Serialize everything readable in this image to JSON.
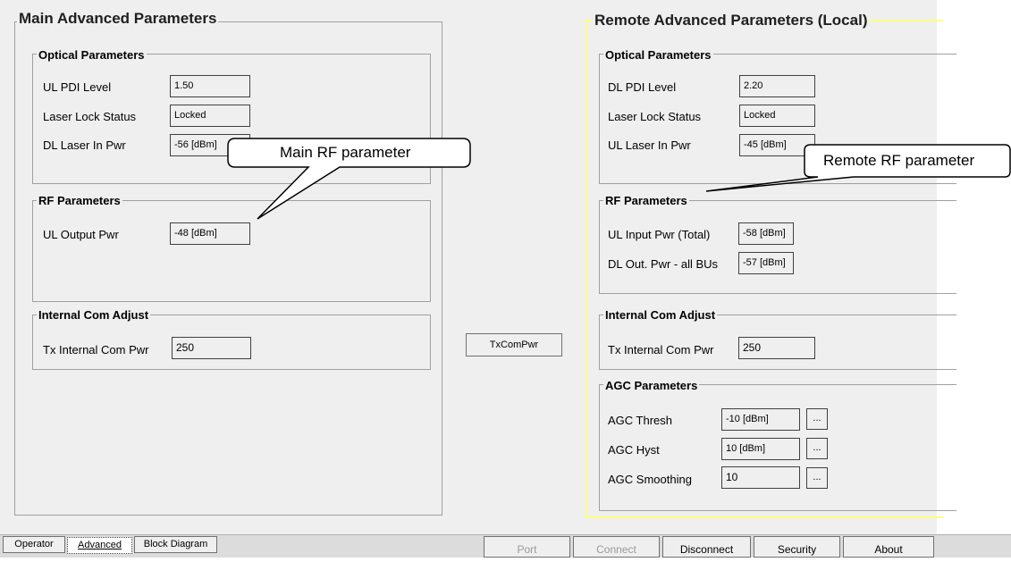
{
  "main": {
    "title": "Main Advanced Parameters",
    "optical": {
      "title": "Optical Parameters",
      "rows": [
        {
          "label": "UL PDI Level",
          "value": "1.50"
        },
        {
          "label": "Laser Lock Status",
          "value": "Locked"
        },
        {
          "label": "DL Laser In Pwr",
          "value": "-56 [dBm]"
        }
      ]
    },
    "rf": {
      "title": "RF Parameters",
      "rows": [
        {
          "label": "UL Output Pwr",
          "value": "-48 [dBm]"
        }
      ]
    },
    "com": {
      "title": "Internal Com Adjust",
      "rows": [
        {
          "label": "Tx Internal Com Pwr",
          "value": "250"
        }
      ]
    }
  },
  "middle": {
    "txcompwr_label": "TxComPwr"
  },
  "remote": {
    "title": "Remote Advanced Parameters (Local)",
    "optical": {
      "title": "Optical Parameters",
      "rows": [
        {
          "label": "DL PDI Level",
          "value": "2.20"
        },
        {
          "label": "Laser Lock Status",
          "value": "Locked"
        },
        {
          "label": "UL Laser In Pwr",
          "value": "-45 [dBm]"
        }
      ]
    },
    "rf": {
      "title": "RF Parameters",
      "rows": [
        {
          "label": "UL Input Pwr (Total)",
          "value": "-58 [dBm]"
        },
        {
          "label": "DL Out. Pwr - all BUs",
          "value": "-57 [dBm]"
        }
      ]
    },
    "com": {
      "title": "Internal Com Adjust",
      "rows": [
        {
          "label": "Tx Internal Com Pwr",
          "value": "250"
        }
      ]
    },
    "agc": {
      "title": "AGC Parameters",
      "rows": [
        {
          "label": "AGC Thresh",
          "value": "-10 [dBm]",
          "button": "..."
        },
        {
          "label": "AGC Hyst",
          "value": "10 [dBm]",
          "button": "..."
        },
        {
          "label": "AGC Smoothing",
          "value": "10",
          "button": "..."
        }
      ]
    }
  },
  "callouts": {
    "main": "Main RF parameter",
    "remote": "Remote RF parameter"
  },
  "tabs": [
    "Operator",
    "Advanced",
    "Block Diagram"
  ],
  "bottom_buttons": [
    {
      "label": "Port",
      "enabled": false
    },
    {
      "label": "Connect",
      "enabled": false
    },
    {
      "label": "Disconnect",
      "enabled": true
    },
    {
      "label": "Security",
      "enabled": true
    },
    {
      "label": "About",
      "enabled": true
    }
  ],
  "colors": {
    "panel_bg": "#efefef",
    "remote_frame": "#ffff80"
  }
}
